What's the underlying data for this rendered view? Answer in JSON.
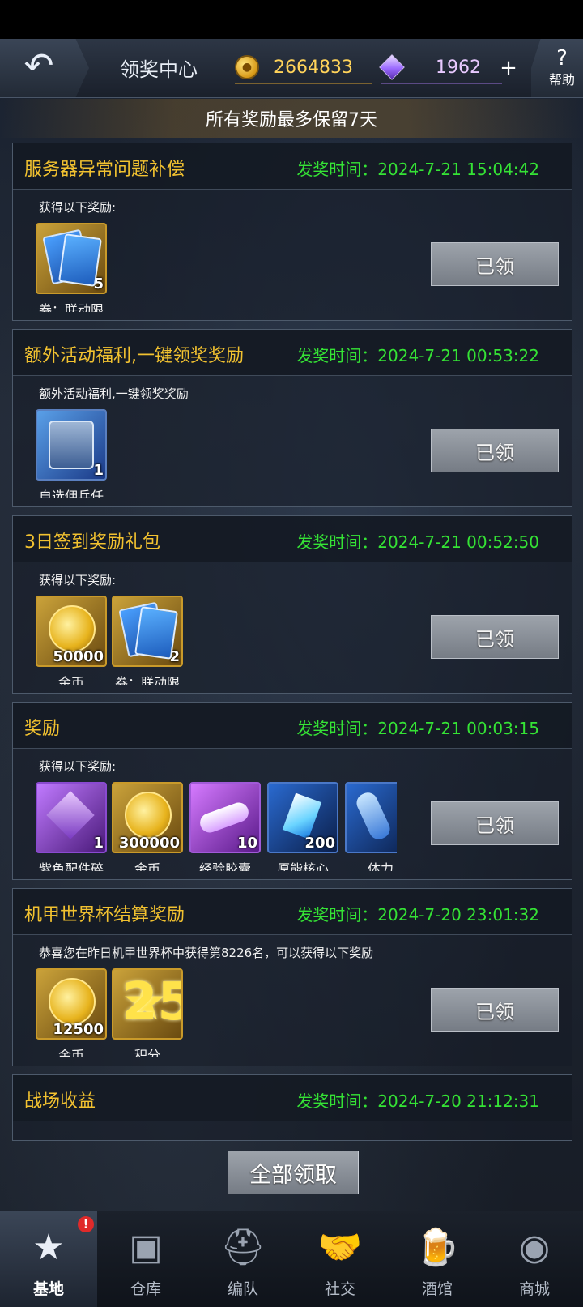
{
  "header": {
    "title": "领奖中心",
    "coins": "2664833",
    "gems": "1962",
    "plus": "+",
    "help_label": "帮助",
    "help_glyph": "?",
    "back_glyph": "↶"
  },
  "notice": "所有奖励最多保留7天",
  "cards": [
    {
      "title": "服务器异常问题补偿",
      "time": "发奖时间：2024-7-21 15:04:42",
      "desc": "获得以下奖励:",
      "button": "已领",
      "items": [
        {
          "icon": "card-ticket-icon",
          "qty": "5",
          "name": "券：联动限"
        }
      ]
    },
    {
      "title": "额外活动福利,一键领奖奖励",
      "time": "发奖时间：2024-7-21 00:53:22",
      "desc": "额外活动福利,一键领奖奖励",
      "button": "已领",
      "items": [
        {
          "icon": "mercenary-box-icon",
          "qty": "1",
          "name": "自选佣兵任"
        }
      ]
    },
    {
      "title": "3日签到奖励礼包",
      "time": "发奖时间：2024-7-21 00:52:50",
      "desc": "获得以下奖励:",
      "button": "已领",
      "items": [
        {
          "icon": "gold-coin-icon",
          "qty": "50000",
          "name": "金币"
        },
        {
          "icon": "card-ticket-icon",
          "qty": "2",
          "name": "券：联动限"
        }
      ]
    },
    {
      "title": "奖励",
      "time": "发奖时间：2024-7-21 00:03:15",
      "desc": "获得以下奖励:",
      "button": "已领",
      "items": [
        {
          "icon": "purple-part-fragment-icon",
          "qty": "1",
          "name": "紫色配件碎"
        },
        {
          "icon": "gold-coin-icon",
          "qty": "300000",
          "name": "金币"
        },
        {
          "icon": "exp-capsule-icon",
          "qty": "10",
          "name": "经验胶囊"
        },
        {
          "icon": "origin-core-icon",
          "qty": "200",
          "name": "原能核心"
        },
        {
          "icon": "stamina-icon",
          "qty": "",
          "name": "体力"
        }
      ]
    },
    {
      "title": "机甲世界杯结算奖励",
      "time": "发奖时间：2024-7-20 23:01:32",
      "desc": "恭喜您在昨日机甲世界杯中获得第8226名，可以获得以下奖励",
      "button": "已领",
      "items": [
        {
          "icon": "gold-coin-icon",
          "qty": "12500",
          "name": "金币"
        },
        {
          "icon": "star-points-icon",
          "qty": "250",
          "name": "积分"
        }
      ]
    },
    {
      "title": "战场收益",
      "time": "发奖时间：2024-7-20 21:12:31"
    }
  ],
  "claim_all": "全部领取",
  "nav": [
    {
      "label": "基地",
      "icon": "base-star-icon",
      "glyph": "★",
      "badge": "!"
    },
    {
      "label": "仓库",
      "icon": "warehouse-icon",
      "glyph": "▣"
    },
    {
      "label": "编队",
      "icon": "formation-helmet-icon",
      "glyph": "⛑"
    },
    {
      "label": "社交",
      "icon": "handshake-icon",
      "glyph": "🤝"
    },
    {
      "label": "酒馆",
      "icon": "tavern-mug-icon",
      "glyph": "🍺"
    },
    {
      "label": "商城",
      "icon": "shop-icon",
      "glyph": "◉"
    }
  ]
}
